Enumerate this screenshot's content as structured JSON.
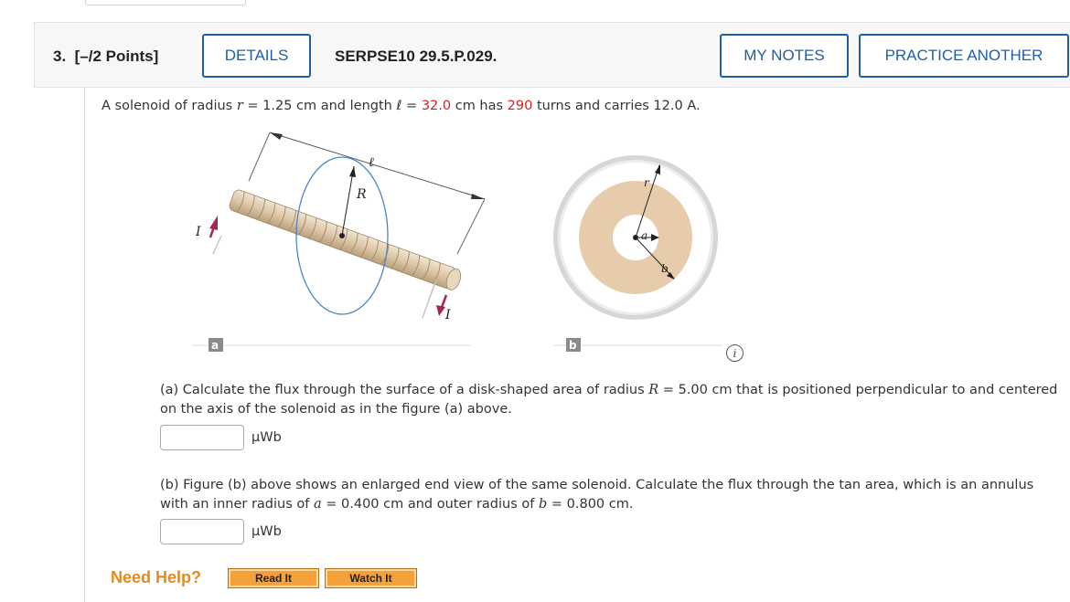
{
  "question": {
    "number_label": "3.",
    "points_label": "[–/2 Points]",
    "details_button": "DETAILS",
    "problem_id": "SERPSE10 29.5.P.029.",
    "my_notes_button": "MY NOTES",
    "practice_button": "PRACTICE ANOTHER"
  },
  "intro": {
    "t1": "A solenoid of radius ",
    "r_sym": "r",
    "t2": " = 1.25 cm and length ℓ = ",
    "length_value": "32.0",
    "t3": " cm has ",
    "turns_value": "290",
    "t4": " turns and carries 12.0 A."
  },
  "figure_a": {
    "panel_label": "a",
    "length_label": "ℓ",
    "radius_label": "R",
    "current_label": "I"
  },
  "figure_b": {
    "panel_label": "b",
    "r_label": "r",
    "a_label": "a",
    "b_label": "b"
  },
  "part_a": {
    "t1": "(a) Calculate the flux through the surface of a disk-shaped area of radius ",
    "sym": "R",
    "t2": " = 5.00 cm that is positioned perpendicular to and centered on the axis of the solenoid as in the figure (a) above.",
    "answer_value": "",
    "unit": "µWb"
  },
  "part_b": {
    "t1": "(b) Figure (b) above shows an enlarged end view of the same solenoid. Calculate the flux through the tan area, which is an annulus with an inner radius of ",
    "sym_a": "a",
    "t2": " = 0.400 cm and outer radius of ",
    "sym_b": "b",
    "t3": " = 0.800 cm.",
    "answer_value": "",
    "unit": "µWb"
  },
  "help": {
    "label": "Need Help?",
    "read_button": "Read It",
    "watch_button": "Watch It"
  },
  "colors": {
    "accent_blue": "#1f5fa8",
    "highlight_red": "#d61f1f",
    "help_orange": "#e8891a",
    "tan": "#e6ccaa"
  },
  "icons": {
    "info": "info-icon"
  }
}
